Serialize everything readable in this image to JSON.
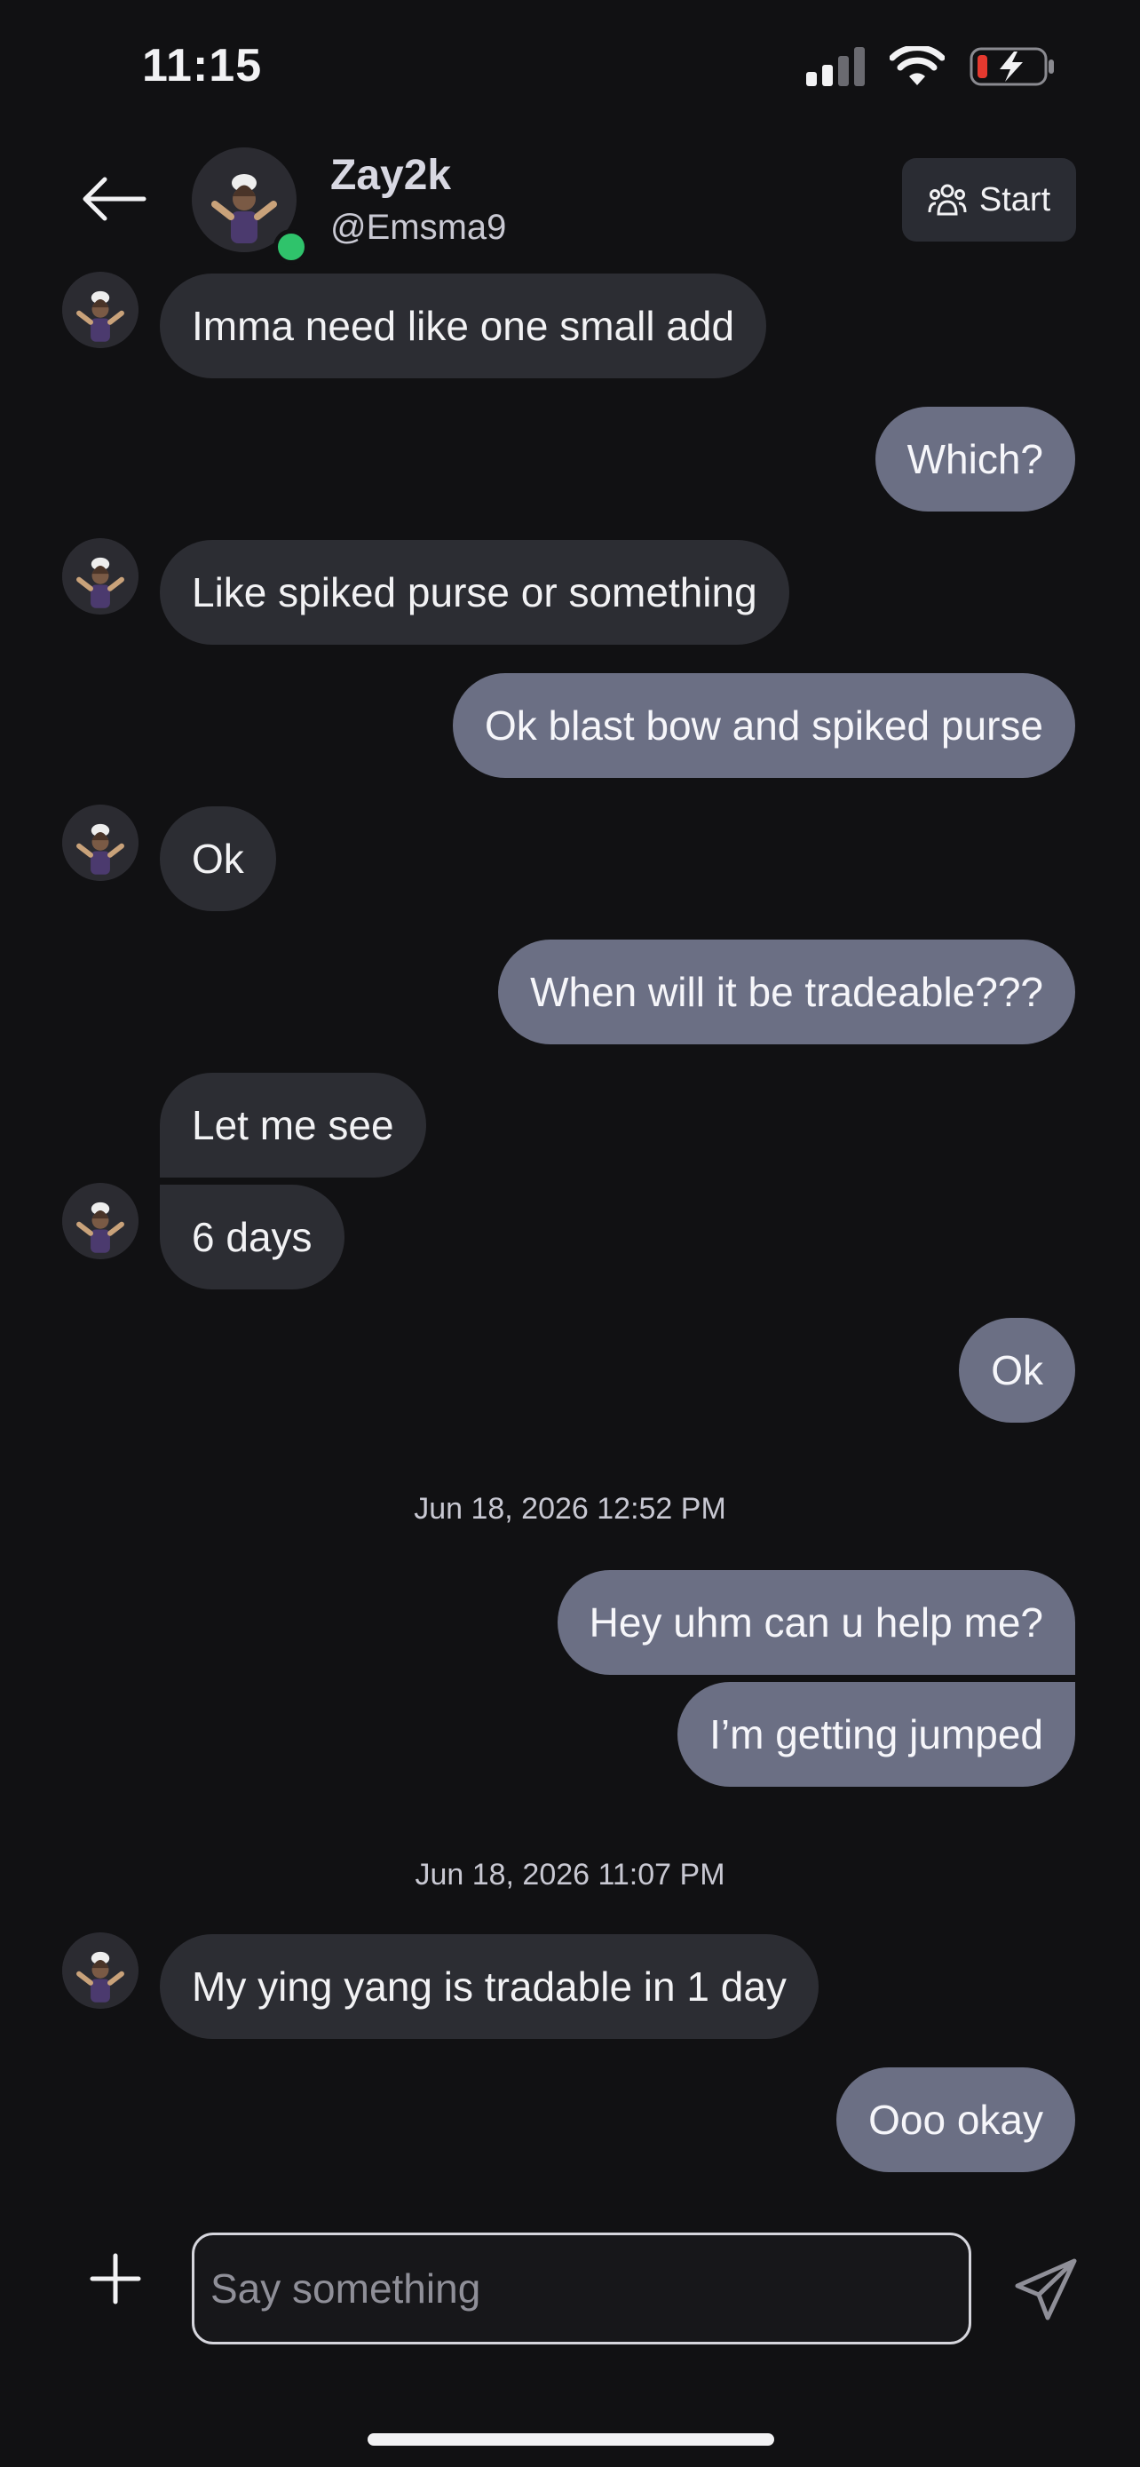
{
  "status_bar": {
    "time": "11:15",
    "icons": [
      "cellular-signal-icon",
      "wifi-icon",
      "battery-charging-icon"
    ]
  },
  "header": {
    "name": "Zay2k",
    "handle": "@Emsma9",
    "start_label": "Start",
    "icons": [
      "back-arrow-icon",
      "people-icon"
    ]
  },
  "messages": [
    {
      "text": "Imma need like one small add"
    },
    {
      "text": "Which?"
    },
    {
      "text": "Like spiked purse or something"
    },
    {
      "text": "Ok blast bow and spiked purse"
    },
    {
      "text": "Ok"
    },
    {
      "text": "When will it be tradeable???"
    },
    {
      "text": "Let me see"
    },
    {
      "text": "6 days"
    },
    {
      "text": "Ok"
    },
    {
      "text": "Hey uhm can u help me?"
    },
    {
      "text": "I’m getting jumped"
    },
    {
      "text": "My ying yang is tradable in 1 day"
    },
    {
      "text": "Ooo okay"
    }
  ],
  "timestamps": [
    "Jun 18, 2026 12:52 PM",
    "Jun 18, 2026 11:07 PM"
  ],
  "composer": {
    "placeholder": "Say something",
    "icons": [
      "plus-icon",
      "send-icon"
    ]
  },
  "colors": {
    "background": "#111113",
    "incoming_bubble": "#2c2d33",
    "outgoing_bubble": "#6b6f84",
    "online": "#2fc36b"
  }
}
